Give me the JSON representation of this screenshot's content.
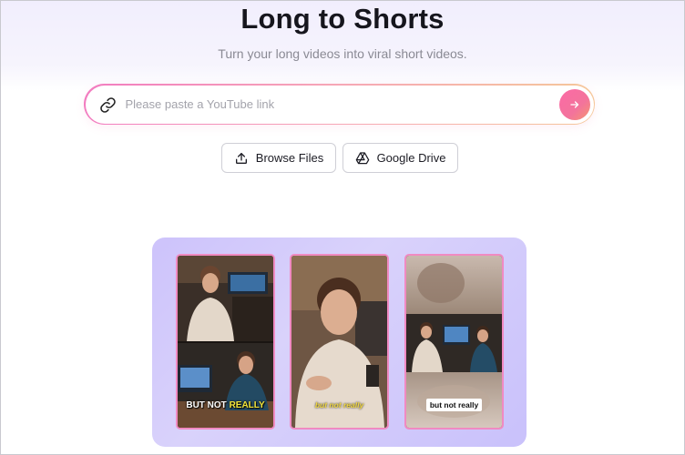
{
  "header": {
    "title": "Long to Shorts",
    "subtitle": "Turn your long videos into viral short videos."
  },
  "search": {
    "placeholder": "Please paste a YouTube link",
    "value": "",
    "link_icon": "link-icon",
    "submit_icon": "arrow-right-icon"
  },
  "actions": {
    "browse_label": "Browse Files",
    "browse_icon": "upload-icon",
    "drive_label": "Google Drive",
    "drive_icon": "google-drive-icon"
  },
  "preview": {
    "frames": [
      {
        "caption_prefix": "BUT NOT ",
        "caption_highlight": "REALLY"
      },
      {
        "caption": "but not really"
      },
      {
        "caption": "but not really"
      }
    ]
  },
  "colors": {
    "accent_pink": "#fb6aa6",
    "accent_orange": "#f5956f",
    "card_lavender": "#cdc3fb",
    "caption_yellow": "#f3e53b"
  }
}
